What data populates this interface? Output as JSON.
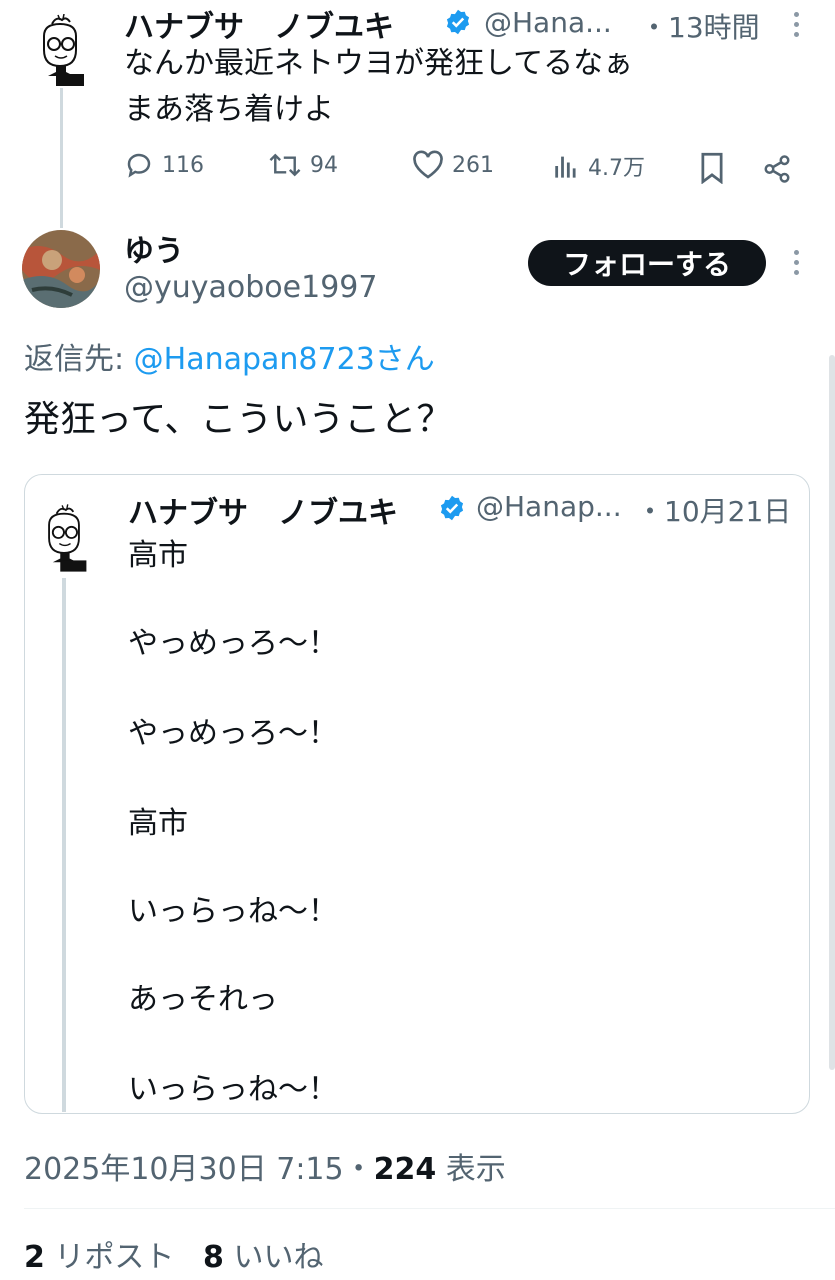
{
  "parent_tweet": {
    "name": "ハナブサ　ノブユキ",
    "handle": "@Hana...",
    "time": "・13時間",
    "text_line1": "なんか最近ネトウヨが発狂してるなぁ",
    "text_line2": "まあ落ち着けよ",
    "replies": "116",
    "reposts": "94",
    "likes": "261",
    "views": "4.7万"
  },
  "reply_tweet": {
    "name": "ゆう",
    "handle": "@yuyaoboe1997",
    "follow_label": "フォローする",
    "reply_to_prefix": "返信先: ",
    "reply_to_handle": "@Hanapan8723さん",
    "text": "発狂って、こういうこと？"
  },
  "quoted_tweet": {
    "name": "ハナブサ　ノブユキ",
    "handle": "@Hanap...",
    "date": "・10月21日",
    "lines": [
      "高市",
      "やっめっろ〜！",
      "やっめっろ〜！",
      "高市",
      "いっらっね〜！",
      "あっそれっ",
      "いっらっね〜！"
    ]
  },
  "meta": {
    "datetime": "2025年10月30日 7:15・",
    "views_count": "224",
    "views_label": " 表示"
  },
  "stats": {
    "reposts_count": "2",
    "reposts_label": " リポスト",
    "likes_count": "8",
    "likes_label": " いいね"
  },
  "colors": {
    "verified": "#1d9bf0",
    "link": "#1d9bf0",
    "secondary": "#536471"
  }
}
